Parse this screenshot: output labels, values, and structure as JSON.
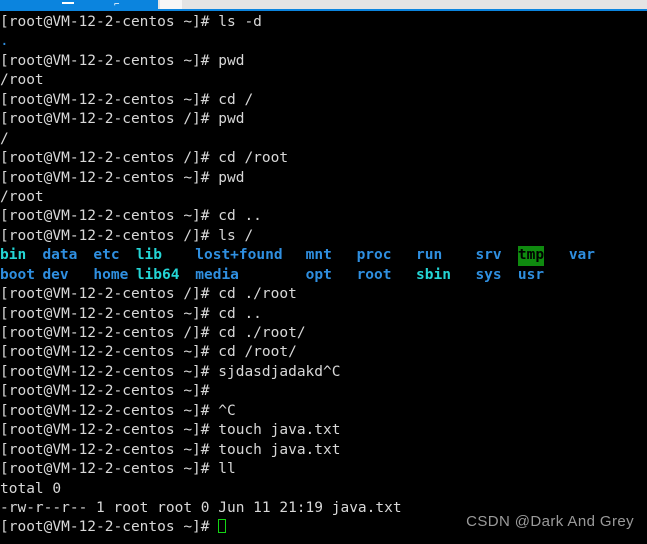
{
  "window": {
    "tab_bar": {
      "active_tab_color": "#0b84de",
      "strip_color": "#e4e4e4",
      "minimize_icon": "minimize-icon",
      "tab_glyph": "⌐"
    }
  },
  "terminal": {
    "prompt_user_host_home": "[root@VM-12-2-centos ~]# ",
    "prompt_user_host_root": "[root@VM-12-2-centos /]# ",
    "colors": {
      "background": "#000000",
      "foreground": "#d8d8d8",
      "directory": "#2f8fe0",
      "symlink": "#24d5d5",
      "sticky_dir_bg": "#0f8a0f",
      "sticky_dir_fg": "#000000",
      "cursor": "#14d414"
    },
    "lines": [
      {
        "type": "prompt",
        "prompt": "[root@VM-12-2-centos ~]# ",
        "command": "ls -d"
      },
      {
        "type": "output",
        "text": ".",
        "color": "directory"
      },
      {
        "type": "prompt",
        "prompt": "[root@VM-12-2-centos ~]# ",
        "command": "pwd"
      },
      {
        "type": "output",
        "text": "/root",
        "color": "foreground"
      },
      {
        "type": "prompt",
        "prompt": "[root@VM-12-2-centos ~]# ",
        "command": "cd /"
      },
      {
        "type": "prompt",
        "prompt": "[root@VM-12-2-centos /]# ",
        "command": "pwd"
      },
      {
        "type": "output",
        "text": "/",
        "color": "foreground"
      },
      {
        "type": "prompt",
        "prompt": "[root@VM-12-2-centos /]# ",
        "command": "cd /root"
      },
      {
        "type": "prompt",
        "prompt": "[root@VM-12-2-centos ~]# ",
        "command": "pwd"
      },
      {
        "type": "output",
        "text": "/root",
        "color": "foreground"
      },
      {
        "type": "prompt",
        "prompt": "[root@VM-12-2-centos ~]# ",
        "command": "cd .."
      },
      {
        "type": "prompt",
        "prompt": "[root@VM-12-2-centos /]# ",
        "command": "ls /"
      },
      {
        "type": "ls-grid"
      },
      {
        "type": "prompt",
        "prompt": "[root@VM-12-2-centos /]# ",
        "command": "cd ./root"
      },
      {
        "type": "prompt",
        "prompt": "[root@VM-12-2-centos ~]# ",
        "command": "cd .."
      },
      {
        "type": "prompt",
        "prompt": "[root@VM-12-2-centos /]# ",
        "command": "cd ./root/"
      },
      {
        "type": "prompt",
        "prompt": "[root@VM-12-2-centos ~]# ",
        "command": "cd /root/"
      },
      {
        "type": "prompt",
        "prompt": "[root@VM-12-2-centos ~]# ",
        "command": "sjdasdjadakd^C"
      },
      {
        "type": "prompt",
        "prompt": "[root@VM-12-2-centos ~]# ",
        "command": ""
      },
      {
        "type": "prompt",
        "prompt": "[root@VM-12-2-centos ~]# ",
        "command": "^C"
      },
      {
        "type": "prompt",
        "prompt": "[root@VM-12-2-centos ~]# ",
        "command": "touch java.txt"
      },
      {
        "type": "prompt",
        "prompt": "[root@VM-12-2-centos ~]# ",
        "command": "touch java.txt"
      },
      {
        "type": "prompt",
        "prompt": "[root@VM-12-2-centos ~]# ",
        "command": "ll"
      },
      {
        "type": "output",
        "text": "total 0",
        "color": "foreground"
      },
      {
        "type": "output",
        "text": "-rw-r--r-- 1 root root 0 Jun 11 21:19 java.txt",
        "color": "foreground"
      },
      {
        "type": "prompt-cursor",
        "prompt": "[root@VM-12-2-centos ~]# ",
        "command": ""
      }
    ],
    "ls_output": {
      "command": "ls /",
      "row1": [
        {
          "name": "bin",
          "kind": "symlink",
          "col": 0
        },
        {
          "name": "data",
          "kind": "dir",
          "col": 5
        },
        {
          "name": "etc",
          "kind": "dir",
          "col": 11
        },
        {
          "name": "lib",
          "kind": "symlink",
          "col": 16
        },
        {
          "name": "lost+found",
          "kind": "dir",
          "col": 23
        },
        {
          "name": "mnt",
          "kind": "dir",
          "col": 36
        },
        {
          "name": "proc",
          "kind": "dir",
          "col": 42
        },
        {
          "name": "run",
          "kind": "dir",
          "col": 49
        },
        {
          "name": "srv",
          "kind": "dir",
          "col": 56
        },
        {
          "name": "tmp",
          "kind": "sticky",
          "col": 61
        },
        {
          "name": "var",
          "kind": "dir",
          "col": 67
        }
      ],
      "row2": [
        {
          "name": "boot",
          "kind": "dir",
          "col": 0
        },
        {
          "name": "dev",
          "kind": "dir",
          "col": 5
        },
        {
          "name": "home",
          "kind": "dir",
          "col": 11
        },
        {
          "name": "lib64",
          "kind": "symlink",
          "col": 16
        },
        {
          "name": "media",
          "kind": "dir",
          "col": 23
        },
        {
          "name": "opt",
          "kind": "dir",
          "col": 36
        },
        {
          "name": "root",
          "kind": "dir",
          "col": 42
        },
        {
          "name": "sbin",
          "kind": "symlink",
          "col": 49
        },
        {
          "name": "sys",
          "kind": "dir",
          "col": 56
        },
        {
          "name": "usr",
          "kind": "dir",
          "col": 61
        }
      ]
    }
  },
  "watermark": {
    "text": "CSDN @Dark And Grey"
  }
}
